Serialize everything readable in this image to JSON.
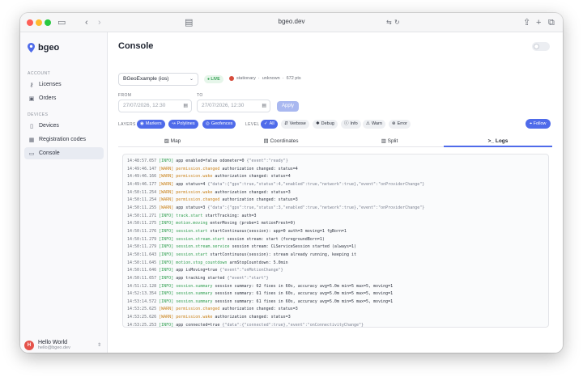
{
  "window": {
    "url": "bgeo.dev"
  },
  "sidebar": {
    "brand": "bgeo",
    "sections": [
      {
        "label": "ACCOUNT",
        "items": [
          {
            "label": "Licenses",
            "icon": "key-icon"
          },
          {
            "label": "Orders",
            "icon": "orders-icon"
          }
        ]
      },
      {
        "label": "DEVICES",
        "items": [
          {
            "label": "Devices",
            "icon": "devices-icon"
          },
          {
            "label": "Registration codes",
            "icon": "qr-icon"
          },
          {
            "label": "Console",
            "icon": "terminal-icon",
            "active": true
          }
        ]
      }
    ],
    "user": {
      "initial": "H",
      "name": "Hello World",
      "email": "hello@bgeo.dev"
    }
  },
  "main": {
    "title": "Console",
    "device_select": "BGeoExample (ios)",
    "live_badge": "● LIVE",
    "status": {
      "state": "stationary",
      "sep1": "·",
      "activity": "unknown",
      "sep2": "·",
      "points": "672 pts"
    },
    "from": {
      "label": "FROM",
      "value": "27/07/2026, 12:30"
    },
    "to": {
      "label": "TO",
      "value": "27/07/2026, 12:30"
    },
    "apply": "Apply",
    "layers": {
      "label": "LAYERS",
      "items": [
        "Markers",
        "Polylines",
        "Geofences"
      ]
    },
    "level": {
      "label": "LEVEL",
      "items": [
        "All",
        "Verbose",
        "Debug",
        "Info",
        "Warn",
        "Error"
      ]
    },
    "follow": "Follow",
    "tabs": [
      "Map",
      "Coordinates",
      "Split",
      "Logs"
    ],
    "active_tab": "Logs"
  },
  "logs": [
    {
      "ts": "14:48:57.057",
      "lvl": "[INFO]",
      "evt": "",
      "msg": "app enabled=false odometer=0 ",
      "json": "{\"event\":\"ready\"}"
    },
    {
      "ts": "14:49:46.147",
      "lvl": "[WARN]",
      "evt": "permission.changed",
      "msg": " authorization changed: status=4",
      "json": ""
    },
    {
      "ts": "14:49:46.166",
      "lvl": "[WARN]",
      "evt": "permission.wake",
      "msg": " authorization changed: status=4",
      "json": ""
    },
    {
      "ts": "14:49:46.177",
      "lvl": "[WARN]",
      "evt": "",
      "msg": "app status=4 ",
      "json": "{\"data\":{\"gps\":true,\"status\":4,\"enabled\":true,\"network\":true},\"event\":\"onProviderChange\"}"
    },
    {
      "ts": "14:50:11.254",
      "lvl": "[WARN]",
      "evt": "permission.wake",
      "msg": " authorization changed: status=3",
      "json": ""
    },
    {
      "ts": "14:50:11.254",
      "lvl": "[WARN]",
      "evt": "permission.changed",
      "msg": " authorization changed: status=3",
      "json": ""
    },
    {
      "ts": "14:50:11.255",
      "lvl": "[WARN]",
      "evt": "",
      "msg": "app status=3 ",
      "json": "{\"data\":{\"gps\":true,\"status\":3,\"enabled\":true,\"network\":true},\"event\":\"onProviderChange\"}"
    },
    {
      "ts": "14:50:11.271",
      "lvl": "[INFO]",
      "evt": "track.start",
      "msg": " startTracking: auth=3",
      "json": ""
    },
    {
      "ts": "14:50:11.275",
      "lvl": "[INFO]",
      "evt": "motion.moving",
      "msg": " enterMoving (probe=1 motionFresh=0)",
      "json": ""
    },
    {
      "ts": "14:50:11.276",
      "lvl": "[INFO]",
      "evt": "session.start",
      "msg": " startContinuous(session): app=0 auth=3 moving=1 fgBorn=1",
      "json": ""
    },
    {
      "ts": "14:50:11.279",
      "lvl": "[INFO]",
      "evt": "session.stream.start",
      "msg": " session stream: start (foregroundBorn=1)",
      "json": ""
    },
    {
      "ts": "14:50:11.279",
      "lvl": "[INFO]",
      "evt": "session.stream.service",
      "msg": " session stream: CLServiceSession started (always=1)",
      "json": ""
    },
    {
      "ts": "14:50:11.643",
      "lvl": "[INFO]",
      "evt": "session.start",
      "msg": " startContinuous(session): stream already running, keeping it",
      "json": ""
    },
    {
      "ts": "14:50:11.645",
      "lvl": "[INFO]",
      "evt": "motion.stop_countdown",
      "msg": " armStopCountdown: 5.0min",
      "json": ""
    },
    {
      "ts": "14:50:11.646",
      "lvl": "[INFO]",
      "evt": "",
      "msg": "app isMoving=true ",
      "json": "{\"event\":\"onMotionChange\"}"
    },
    {
      "ts": "14:50:11.657",
      "lvl": "[INFO]",
      "evt": "",
      "msg": "app tracking started ",
      "json": "{\"event\":\"start\"}"
    },
    {
      "ts": "14:51:12.128",
      "lvl": "[INFO]",
      "evt": "session.summary",
      "msg": " session summary: 62 fixes in 60s, accuracy avg=5.0m min=5 max=5, moving=1",
      "json": ""
    },
    {
      "ts": "14:52:13.354",
      "lvl": "[INFO]",
      "evt": "session.summary",
      "msg": " session summary: 61 fixes in 60s, accuracy avg=5.0m min=5 max=5, moving=1",
      "json": ""
    },
    {
      "ts": "14:53:14.572",
      "lvl": "[INFO]",
      "evt": "session.summary",
      "msg": " session summary: 61 fixes in 60s, accuracy avg=5.0m min=5 max=5, moving=1",
      "json": ""
    },
    {
      "ts": "14:53:25.625",
      "lvl": "[WARN]",
      "evt": "permission.changed",
      "msg": " authorization changed: status=3",
      "json": ""
    },
    {
      "ts": "14:53:25.626",
      "lvl": "[WARN]",
      "evt": "permission.wake",
      "msg": " authorization changed: status=3",
      "json": ""
    },
    {
      "ts": "14:53:25.253",
      "lvl": "[INFO]",
      "evt": "",
      "msg": "app connected=true ",
      "json": "{\"data\":{\"connected\":true},\"event\":\"onConnectivityChange\"}"
    }
  ],
  "colors": {
    "accent": "#4f6bea",
    "info": "#2f9e4f",
    "warn": "#c9821b",
    "live": "#2f9e4f"
  }
}
